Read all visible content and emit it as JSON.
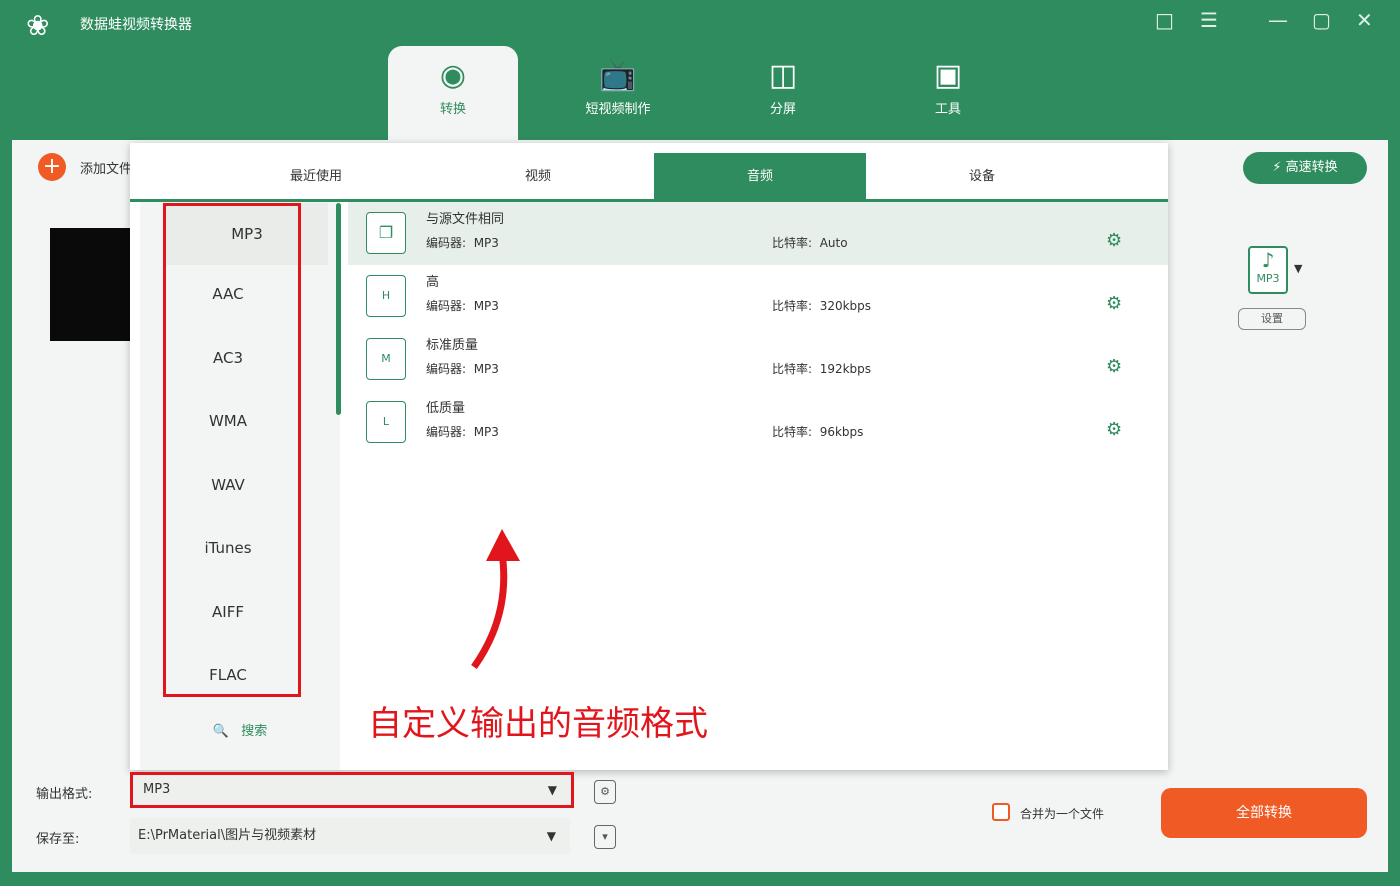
{
  "app": {
    "title": "数据蛙视频转换器"
  },
  "nav": [
    {
      "label": "转换",
      "icon": "convert-icon"
    },
    {
      "label": "短视频制作",
      "icon": "tv-icon"
    },
    {
      "label": "分屏",
      "icon": "split-screen-icon"
    },
    {
      "label": "工具",
      "icon": "toolbox-icon"
    }
  ],
  "toolbar": {
    "add_file": "添加文件",
    "fast_convert": "高速转换",
    "settings": "设置",
    "mp3_badge": "MP3"
  },
  "format_tabs": [
    "最近使用",
    "视频",
    "音频",
    "设备"
  ],
  "formats": [
    "MP3",
    "AAC",
    "AC3",
    "WMA",
    "WAV",
    "iTunes",
    "AIFF",
    "FLAC"
  ],
  "search_label": "搜索",
  "presets": [
    {
      "name": "与源文件相同",
      "encoder_label": "编码器:",
      "encoder": "MP3",
      "bitrate_label": "比特率:",
      "bitrate": "Auto",
      "badge": ""
    },
    {
      "name": "高",
      "encoder_label": "编码器:",
      "encoder": "MP3",
      "bitrate_label": "比特率:",
      "bitrate": "320kbps",
      "badge": "H"
    },
    {
      "name": "标准质量",
      "encoder_label": "编码器:",
      "encoder": "MP3",
      "bitrate_label": "比特率:",
      "bitrate": "192kbps",
      "badge": "M"
    },
    {
      "name": "低质量",
      "encoder_label": "编码器:",
      "encoder": "MP3",
      "bitrate_label": "比特率:",
      "bitrate": "96kbps",
      "badge": "L"
    }
  ],
  "annotation": "自定义输出的音频格式",
  "bottom": {
    "output_format_label": "输出格式:",
    "output_format": "MP3",
    "save_to_label": "保存至:",
    "save_path": "E:\\PrMaterial\\图片与视频素材",
    "merge_label": "合并为一个文件",
    "convert_all": "全部转换"
  },
  "colors": {
    "brand": "#2f8c5e",
    "accent": "#f05a24",
    "annotation": "#e0161c"
  }
}
